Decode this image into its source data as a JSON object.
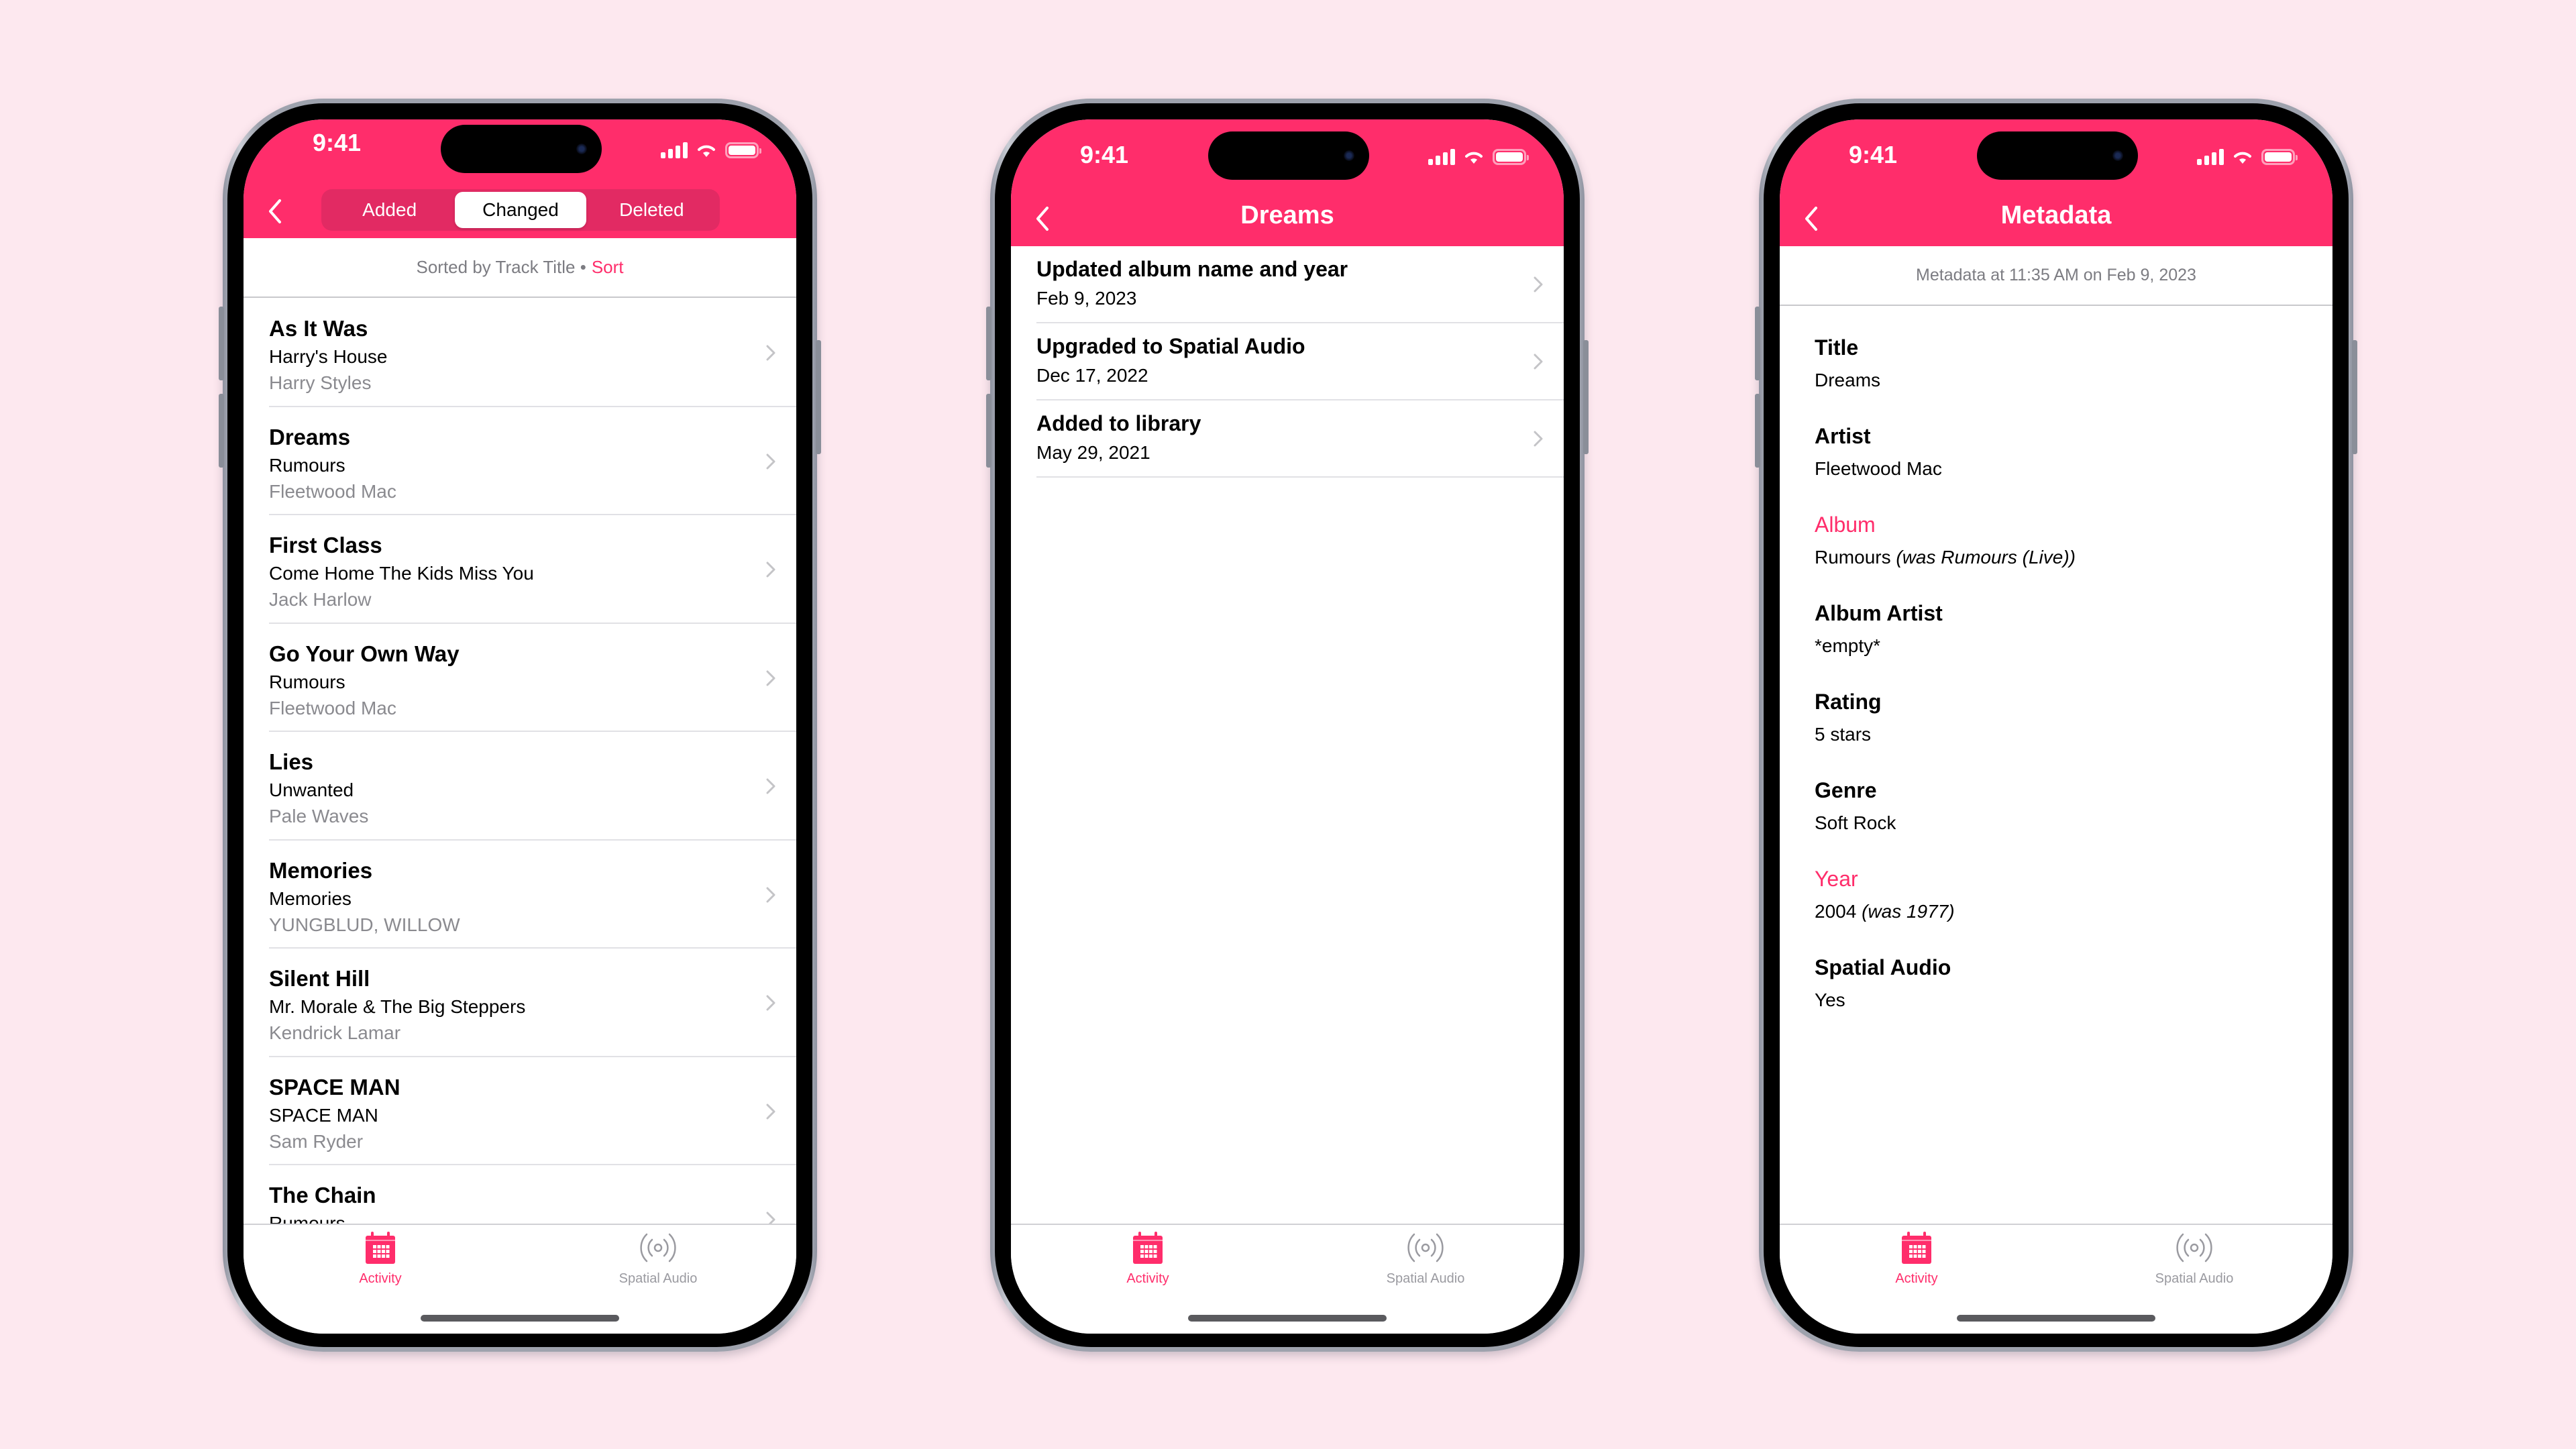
{
  "theme": {
    "accent": "#ff2d6b",
    "background": "#fde8ef"
  },
  "status_bar": {
    "time": "9:41"
  },
  "tabbar": {
    "items": [
      {
        "label": "Activity",
        "icon": "calendar-icon",
        "active": true
      },
      {
        "label": "Spatial Audio",
        "icon": "spatial-audio-icon",
        "active": false
      }
    ]
  },
  "phone1": {
    "segments": [
      {
        "label": "Added",
        "active": false
      },
      {
        "label": "Changed",
        "active": true
      },
      {
        "label": "Deleted",
        "active": false
      }
    ],
    "sort_text": "Sorted by Track Title •",
    "sort_link": "Sort",
    "tracks": [
      {
        "title": "As It Was",
        "album": "Harry's House",
        "artist": "Harry Styles"
      },
      {
        "title": "Dreams",
        "album": "Rumours",
        "artist": "Fleetwood Mac"
      },
      {
        "title": "First Class",
        "album": "Come Home The Kids Miss You",
        "artist": "Jack Harlow"
      },
      {
        "title": "Go Your Own Way",
        "album": "Rumours",
        "artist": "Fleetwood Mac"
      },
      {
        "title": "Lies",
        "album": "Unwanted",
        "artist": "Pale Waves"
      },
      {
        "title": "Memories",
        "album": "Memories",
        "artist": "YUNGBLUD, WILLOW"
      },
      {
        "title": "Silent Hill",
        "album": "Mr. Morale & The Big Steppers",
        "artist": "Kendrick Lamar"
      },
      {
        "title": "SPACE MAN",
        "album": "SPACE MAN",
        "artist": "Sam Ryder"
      },
      {
        "title": "The Chain",
        "album": "Rumours",
        "artist": ""
      }
    ]
  },
  "phone2": {
    "title": "Dreams",
    "events": [
      {
        "title": "Updated album name and year",
        "date": "Feb 9, 2023"
      },
      {
        "title": "Upgraded to Spatial Audio",
        "date": "Dec 17, 2022"
      },
      {
        "title": "Added to library",
        "date": "May 29, 2021"
      }
    ]
  },
  "phone3": {
    "title": "Metadata",
    "subtitle": "Metadata at 11:35 AM on Feb 9, 2023",
    "fields": [
      {
        "label": "Title",
        "value": "Dreams",
        "was": "",
        "changed": false
      },
      {
        "label": "Artist",
        "value": "Fleetwood Mac",
        "was": "",
        "changed": false
      },
      {
        "label": "Album",
        "value": "Rumours",
        "was": "(was Rumours (Live))",
        "changed": true
      },
      {
        "label": "Album Artist",
        "value": "*empty*",
        "was": "",
        "changed": false
      },
      {
        "label": "Rating",
        "value": "5 stars",
        "was": "",
        "changed": false
      },
      {
        "label": "Genre",
        "value": "Soft Rock",
        "was": "",
        "changed": false
      },
      {
        "label": "Year",
        "value": "2004",
        "was": "(was 1977)",
        "changed": true
      },
      {
        "label": "Spatial Audio",
        "value": "Yes",
        "was": "",
        "changed": false
      }
    ]
  }
}
